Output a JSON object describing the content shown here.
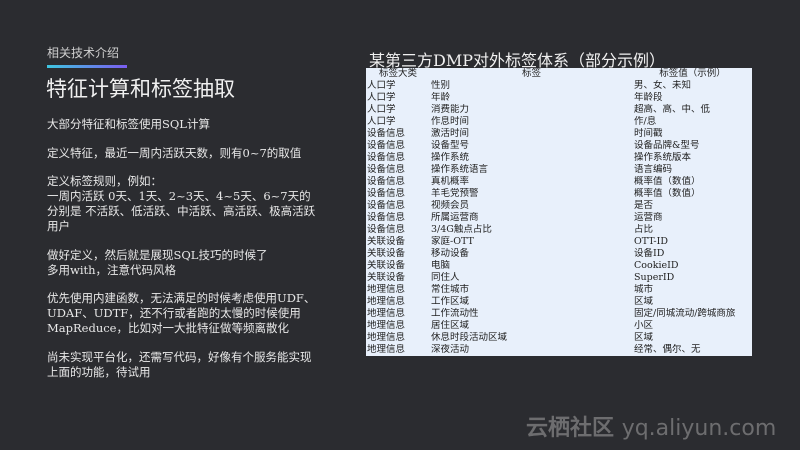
{
  "section_label": "相关技术介绍",
  "title": "特征计算和标签抽取",
  "body": [
    [
      "大部分特征和标签使用SQL计算"
    ],
    [
      "定义特征，最近一周内活跃天数，则有0~7的取值"
    ],
    [
      "定义标签规则，例如：",
      "一周内活跃 0天、1天、2~3天、4~5天、6~7天的",
      "分别是 不活跃、低活跃、中活跃、高活跃、极高活跃",
      "用户"
    ],
    [
      "做好定义，然后就是展现SQL技巧的时候了",
      "多用with，注意代码风格"
    ],
    [
      "优先使用内建函数，无法满足的时候考虑使用UDF、",
      "UDAF、UDTF，还不行或者跑的太慢的时候使用",
      "MapReduce，比如对一大批特征做等频离散化"
    ],
    [
      "尚未实现平台化，还需写代码，好像有个服务能实现",
      "上面的功能，待试用"
    ]
  ],
  "table_title": "某第三方DMP对外标签体系（部分示例）",
  "table": {
    "headers": [
      "标签大类",
      "标签",
      "标签值（示例）"
    ],
    "rows": [
      [
        "人口学",
        "性别",
        "男、女、未知"
      ],
      [
        "人口学",
        "年龄",
        "年龄段"
      ],
      [
        "人口学",
        "消费能力",
        "超高、高、中、低"
      ],
      [
        "人口学",
        "作息时间",
        "作/息"
      ],
      [
        "设备信息",
        "激活时间",
        "时间戳"
      ],
      [
        "设备信息",
        "设备型号",
        "设备品牌&型号"
      ],
      [
        "设备信息",
        "操作系统",
        "操作系统版本"
      ],
      [
        "设备信息",
        "操作系统语言",
        "语言编码"
      ],
      [
        "设备信息",
        "真机概率",
        "概率值（数值）"
      ],
      [
        "设备信息",
        "羊毛党预警",
        "概率值（数值）"
      ],
      [
        "设备信息",
        "视频会员",
        "是否"
      ],
      [
        "设备信息",
        "所属运营商",
        "运营商"
      ],
      [
        "设备信息",
        "3/4G触点占比",
        "占比"
      ],
      [
        "关联设备",
        "家庭-OTT",
        "OTT-ID"
      ],
      [
        "关联设备",
        "移动设备",
        "设备ID"
      ],
      [
        "关联设备",
        "电脑",
        "CookieID"
      ],
      [
        "关联设备",
        "同住人",
        "SuperID"
      ],
      [
        "地理信息",
        "常住城市",
        "城市"
      ],
      [
        "地理信息",
        "工作区域",
        "区域"
      ],
      [
        "地理信息",
        "工作流动性",
        "固定/同城流动/跨城商旅"
      ],
      [
        "地理信息",
        "居住区域",
        "小区"
      ],
      [
        "地理信息",
        "休息时段活动区域",
        "区域"
      ],
      [
        "地理信息",
        "深夜活动",
        "经常、偶尔、无"
      ]
    ]
  },
  "watermark": {
    "brand": "云栖社区",
    "url": "yq.aliyun.com"
  }
}
